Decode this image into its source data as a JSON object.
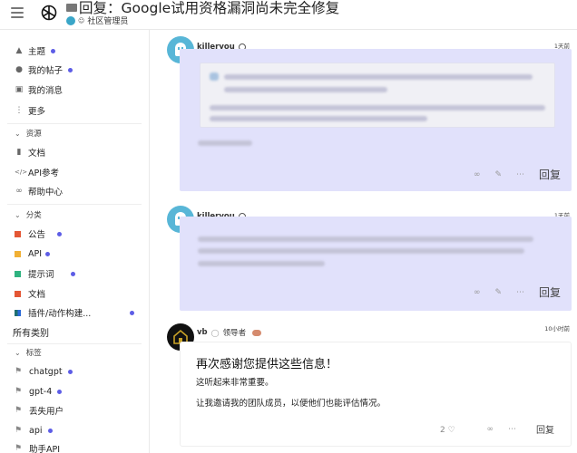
{
  "header": {
    "title": "回复：Google试用资格漏洞尚未完全修复",
    "category": "社区管理员"
  },
  "sidebar": {
    "top_items": [
      {
        "label": "主题",
        "icon": "stack-icon",
        "dot": true
      },
      {
        "label": "我的帖子",
        "icon": "user-icon",
        "dot": true
      },
      {
        "label": "我的消息",
        "icon": "inbox-icon",
        "dot": false
      },
      {
        "label": "更多",
        "icon": "more-vertical-icon",
        "dot": false
      }
    ],
    "resources_heading": "资源",
    "resources": [
      {
        "label": "文档",
        "icon": "book-icon"
      },
      {
        "label": "API参考",
        "icon": "code-icon"
      },
      {
        "label": "帮助中心",
        "icon": "link-icon"
      }
    ],
    "categories_heading": "分类",
    "categories": [
      {
        "label": "公告",
        "color": "#e45735",
        "dot": true
      },
      {
        "label": "API",
        "color": "#f1b035",
        "dot": true
      },
      {
        "label": "提示词",
        "color": "#2fb380",
        "dot": true
      },
      {
        "label": "文档",
        "color": "#e45735",
        "dot": false
      },
      {
        "label": "插件/动作构建...",
        "color": "#1f6f6f",
        "dot": true
      }
    ],
    "all_categories": "所有类别",
    "tags_heading": "标签",
    "tags": [
      {
        "label": "chatgpt",
        "dot": true
      },
      {
        "label": "gpt-4",
        "dot": true
      },
      {
        "label": "丢失用户",
        "dot": false
      },
      {
        "label": "api",
        "dot": true
      },
      {
        "label": "助手API",
        "dot": false
      }
    ]
  },
  "posts": [
    {
      "username": "killeryou",
      "time": "1天前",
      "reply": "回复"
    },
    {
      "username": "killeryou",
      "time": "1天前",
      "reply": "回复"
    },
    {
      "username": "vb",
      "role": "领导者",
      "time": "10小时前",
      "heading": "再次感谢您提供这些信息！",
      "lines": [
        "这听起来非常重要。",
        "让我邀请我的团队成员，以便他们也能评估情况。"
      ],
      "likes": "2",
      "reply": "回复"
    }
  ],
  "colors": {
    "accent_dot": "#5d5de6",
    "post_bg": "#e1e1fb",
    "avatar_blue": "#58b6d7"
  }
}
